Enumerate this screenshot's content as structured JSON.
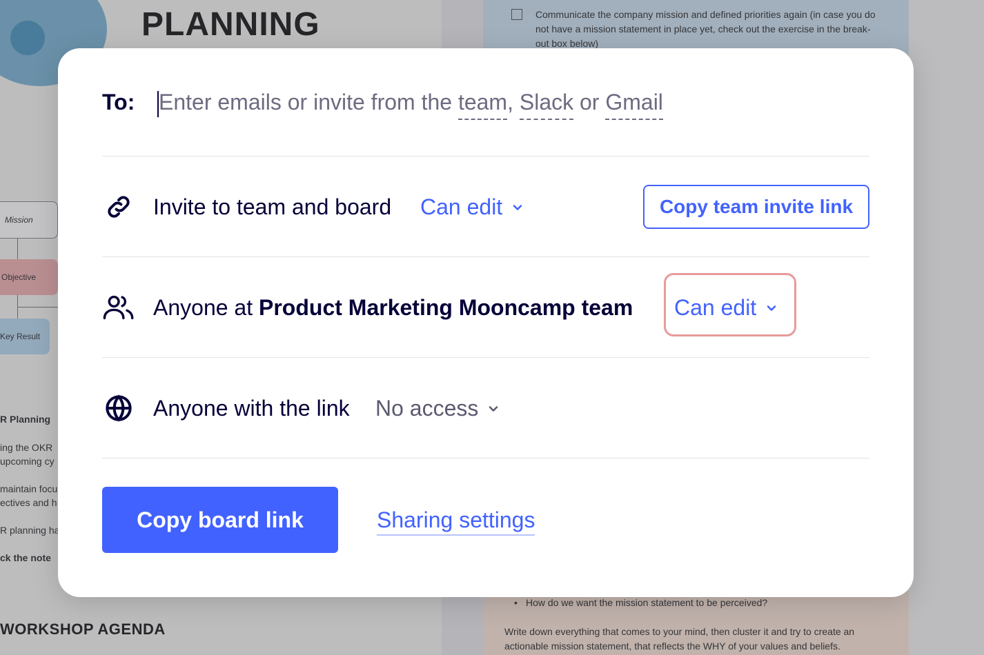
{
  "background": {
    "board_title": "PLANNING",
    "checklist_text": "Communicate the company mission and defined priorities again (in case you do not have a mission statement in place yet, check out the exercise in the break-out box below)",
    "nodes": {
      "mission": "Mission",
      "objective": "Objective",
      "key_result": "Key Result"
    },
    "left_snippets": [
      "R Planning",
      "ing the OKR",
      "upcoming cy",
      "maintain focu",
      "ectives and h",
      "R planning ha",
      "ck the note"
    ],
    "agenda_title": "WORKSHOP AGENDA",
    "right_bullet": "How do we want the mission statement to be perceived?",
    "right_paragraph": "Write down everything that comes to your mind, then cluster it and try to create an actionable mission statement, that reflects the WHY of your values and beliefs."
  },
  "modal": {
    "to_label": "To:",
    "to_input": {
      "value": "",
      "placeholder_prefix": "Enter emails or invite from the ",
      "placeholder_team": "team",
      "placeholder_sep1": ", ",
      "placeholder_slack": "Slack",
      "placeholder_sep2": " or ",
      "placeholder_gmail": "Gmail"
    },
    "invite_row": {
      "icon": "link-icon",
      "label": "Invite to team and board",
      "permission": "Can edit",
      "copy_button": "Copy team invite link"
    },
    "team_row": {
      "icon": "users-icon",
      "label_prefix": "Anyone at ",
      "team_name": "Product Marketing Mooncamp team",
      "permission": "Can edit"
    },
    "link_row": {
      "icon": "globe-icon",
      "label": "Anyone with the link",
      "permission": "No access"
    },
    "copy_board_button": "Copy board link",
    "sharing_settings_link": "Sharing settings"
  },
  "colors": {
    "accent": "#4262ff",
    "text_dark": "#050038",
    "highlight": "#e89a9a"
  }
}
